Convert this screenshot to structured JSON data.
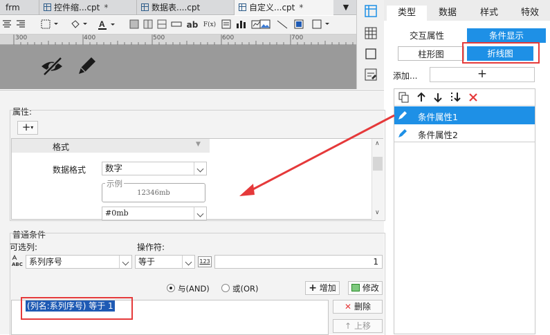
{
  "tabs": [
    {
      "label": "frm",
      "has_icon": false,
      "close": "",
      "active": false
    },
    {
      "label": "控件缩...cpt",
      "has_icon": true,
      "close": "*",
      "active": false
    },
    {
      "label": "数据表....cpt",
      "has_icon": true,
      "close": "",
      "active": false
    },
    {
      "label": "自定义...cpt",
      "has_icon": true,
      "close": "*",
      "active": true
    }
  ],
  "toolbar": {
    "text_ab": "ab",
    "fx": "F(x)"
  },
  "ruler": {
    "labels": [
      "300",
      "400",
      "500",
      "600",
      "700"
    ]
  },
  "right_panel": {
    "tabs": [
      "类型",
      "数据",
      "样式",
      "特效"
    ],
    "active_tab": "类型",
    "sub_tabs": [
      "交互属性",
      "条件显示"
    ],
    "chart_buttons": [
      "柱形图",
      "折线图"
    ],
    "add_label": "添加...",
    "add_plus": "+",
    "conditions": [
      "条件属性1",
      "条件属性2"
    ]
  },
  "dialog": {
    "properties_label": "属性:",
    "format_label": "格式",
    "data_format_label": "数据格式",
    "data_format_value": "数字",
    "example_label": "示例",
    "example_value": "12346mb",
    "pattern_value": "#0mb",
    "normal_condition_label": "普通条件",
    "optional_column_label": "可选列:",
    "operator_label": "操作符:",
    "column_value": "系列序号",
    "operator_value": "等于",
    "value_input": "1",
    "and_label": "与(AND)",
    "or_label": "或(OR)",
    "add_button": "增加",
    "modify_button": "修改",
    "delete_button": "删除",
    "up_button": "上移",
    "condition_text": "(列名:系列序号) 等于 1"
  },
  "colors": {
    "accent": "#1e90e6",
    "highlight": "#e5393a",
    "selection": "#1e5ab4"
  }
}
